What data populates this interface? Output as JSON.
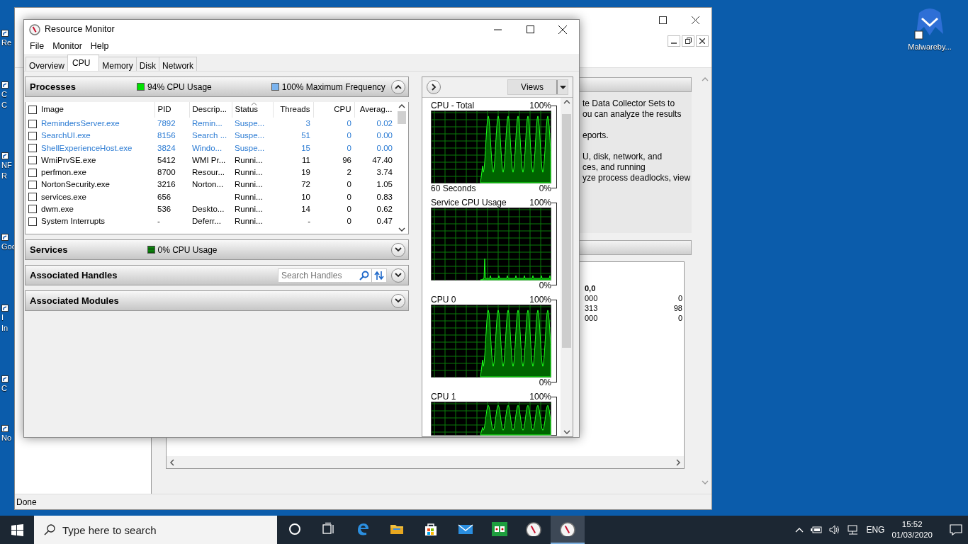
{
  "desktop": {
    "icons": [
      {
        "lines": [
          "Re"
        ]
      },
      {
        "lines": [
          "C",
          "C"
        ]
      },
      {
        "lines": [
          "NF",
          "R"
        ]
      },
      {
        "lines": [
          "Goo"
        ]
      },
      {
        "lines": [
          "I",
          "In"
        ]
      },
      {
        "lines": [
          "C"
        ]
      },
      {
        "lines": [
          "No"
        ]
      }
    ],
    "right_icon": {
      "label": "Malwareby..."
    }
  },
  "background_window": {
    "description_paragraphs": [
      [
        "te Data Collector Sets to",
        "ou can analyze the results"
      ],
      [
        "eports."
      ],
      [
        "U, disk, network, and",
        "ces, and running",
        "yze process deadlocks, view"
      ]
    ],
    "summary_heading": "0,0",
    "summary_rows": [
      {
        "column_1": "000",
        "column_2": "0"
      },
      {
        "column_1": "313",
        "column_2": "98"
      },
      {
        "column_1": "000",
        "column_2": "0"
      }
    ],
    "status_bar": "Done"
  },
  "window": {
    "title": "Resource Monitor"
  },
  "menu": [
    "File",
    "Monitor",
    "Help"
  ],
  "tabs": [
    {
      "label": "Overview",
      "selected": false
    },
    {
      "label": "CPU",
      "selected": true
    },
    {
      "label": "Memory",
      "selected": false
    },
    {
      "label": "Disk",
      "selected": false
    },
    {
      "label": "Network",
      "selected": false
    }
  ],
  "processes": {
    "title": "Processes",
    "cpu_usage": "94% CPU Usage",
    "max_frequency": "100% Maximum Frequency",
    "expanded": true,
    "select_all_checked": false,
    "columns": [
      "Image",
      "PID",
      "Descrip...",
      "Status",
      "Threads",
      "CPU",
      "Averag..."
    ],
    "rows": [
      {
        "image": "RemindersServer.exe",
        "pid": "7892",
        "description": "Remin...",
        "status": "Suspe...",
        "threads": "3",
        "cpu": "0",
        "average": "0.02",
        "suspended": true,
        "checked": false
      },
      {
        "image": "SearchUI.exe",
        "pid": "8156",
        "description": "Search ...",
        "status": "Suspe...",
        "threads": "51",
        "cpu": "0",
        "average": "0.00",
        "suspended": true,
        "checked": false
      },
      {
        "image": "ShellExperienceHost.exe",
        "pid": "3824",
        "description": "Windo...",
        "status": "Suspe...",
        "threads": "15",
        "cpu": "0",
        "average": "0.00",
        "suspended": true,
        "checked": false
      },
      {
        "image": "WmiPrvSE.exe",
        "pid": "5412",
        "description": "WMI Pr...",
        "status": "Runni...",
        "threads": "11",
        "cpu": "96",
        "average": "47.40",
        "suspended": false,
        "checked": false
      },
      {
        "image": "perfmon.exe",
        "pid": "8700",
        "description": "Resour...",
        "status": "Runni...",
        "threads": "19",
        "cpu": "2",
        "average": "3.74",
        "suspended": false,
        "checked": false
      },
      {
        "image": "NortonSecurity.exe",
        "pid": "3216",
        "description": "Norton...",
        "status": "Runni...",
        "threads": "72",
        "cpu": "0",
        "average": "1.05",
        "suspended": false,
        "checked": false
      },
      {
        "image": "services.exe",
        "pid": "656",
        "description": "",
        "status": "Runni...",
        "threads": "10",
        "cpu": "0",
        "average": "0.83",
        "suspended": false,
        "checked": false
      },
      {
        "image": "dwm.exe",
        "pid": "536",
        "description": "Deskto...",
        "status": "Runni...",
        "threads": "14",
        "cpu": "0",
        "average": "0.62",
        "suspended": false,
        "checked": false
      },
      {
        "image": "System Interrupts",
        "pid": "-",
        "description": "Deferr...",
        "status": "Runni...",
        "threads": "-",
        "cpu": "0",
        "average": "0.47",
        "suspended": false,
        "checked": false
      }
    ]
  },
  "panels": [
    {
      "kind": "usage",
      "title": "Services",
      "usage": "0% CPU Usage",
      "expanded": false
    },
    {
      "kind": "search",
      "title": "Associated Handles",
      "placeholder": "Search Handles",
      "expanded": false
    },
    {
      "kind": "plain",
      "title": "Associated Modules",
      "expanded": false
    }
  ],
  "graphs": {
    "views_button": "Views",
    "items": [
      {
        "kind": "cpu",
        "title": "CPU - Total",
        "max": "100%",
        "caption": "60 Seconds",
        "min": "0%"
      },
      {
        "kind": "service",
        "title": "Service CPU Usage",
        "max": "100%",
        "min": "0%"
      },
      {
        "kind": "cpu",
        "title": "CPU 0",
        "max": "100%",
        "min": "0%"
      },
      {
        "kind": "cpu_cut",
        "title": "CPU 1",
        "max": "100%"
      }
    ]
  },
  "taskbar": {
    "search_placeholder": "Type here to search",
    "apps": [
      {
        "kind": "cortana",
        "selected": false
      },
      {
        "kind": "taskview",
        "selected": false
      },
      {
        "kind": "edge",
        "selected": false
      },
      {
        "kind": "explorer",
        "selected": false
      },
      {
        "kind": "store",
        "selected": false
      },
      {
        "kind": "mail",
        "selected": false
      },
      {
        "kind": "solitaire",
        "selected": false
      },
      {
        "kind": "gauge",
        "selected": false
      },
      {
        "kind": "gauge",
        "selected": true
      }
    ],
    "language": "ENG",
    "time": "15:52",
    "date": "01/03/2020"
  }
}
